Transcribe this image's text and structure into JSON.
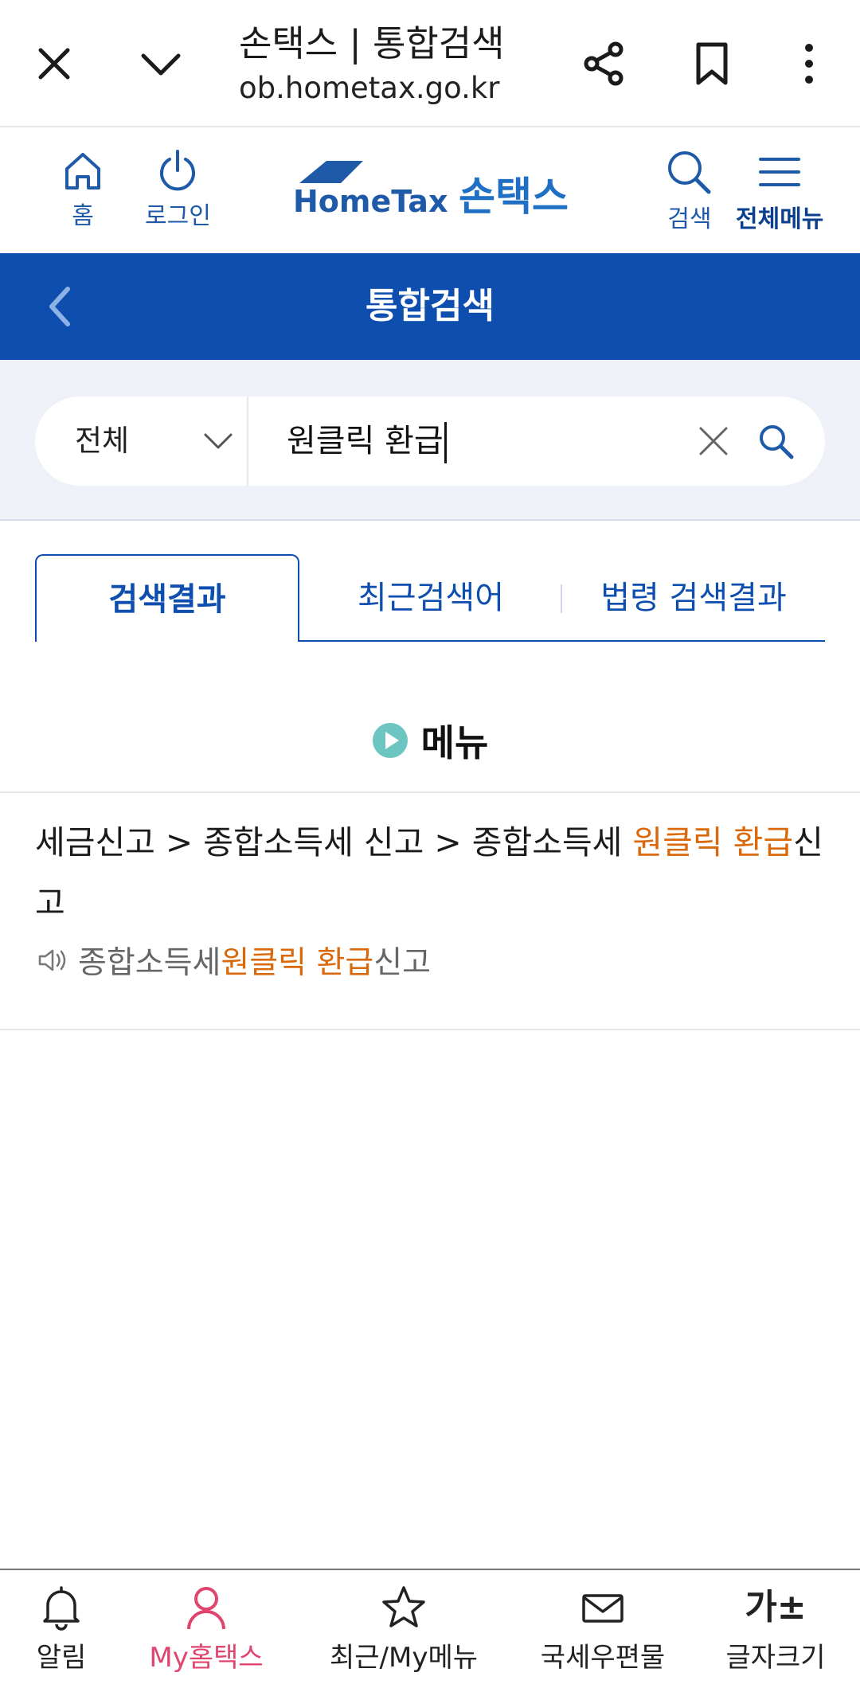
{
  "browser": {
    "title": "손택스 | 통합검색",
    "url": "ob.hometax.go.kr",
    "icons": [
      "close-icon",
      "chevron-down-icon",
      "share-icon",
      "bookmark-icon",
      "more-icon"
    ]
  },
  "header": {
    "home_label": "홈",
    "login_label": "로그인",
    "logo_brand": "HomeTax",
    "logo_korean": "손택스",
    "search_label": "검색",
    "menu_label": "전체메뉴"
  },
  "title_band": {
    "title": "통합검색"
  },
  "search": {
    "scope": "전체",
    "query": "원클릭 환급"
  },
  "tabs": [
    {
      "label": "검색결과",
      "active": true
    },
    {
      "label": "최근검색어",
      "active": false
    },
    {
      "label": "법령 검색결과",
      "active": false
    }
  ],
  "results": {
    "section_title": "메뉴",
    "item": {
      "path_pre": "세금신고 > 종합소득세 신고 > 종합소득세 ",
      "path_hl": "원클릭 환급",
      "path_post": "신고",
      "sub_pre": "종합소득세 ",
      "sub_hl": "원클릭 환급",
      "sub_post": "신고"
    }
  },
  "bottom_nav": [
    {
      "label": "알림",
      "icon": "bell-icon",
      "active": false
    },
    {
      "label": "My홈택스",
      "icon": "person-icon",
      "active": true
    },
    {
      "label": "최근/My메뉴",
      "icon": "star-icon",
      "active": false
    },
    {
      "label": "국세우편물",
      "icon": "mail-icon",
      "active": false
    },
    {
      "label": "글자크기",
      "icon": "font-size-icon",
      "glyph": "가±",
      "active": false
    }
  ],
  "colors": {
    "primary_blue": "#0d4eaf",
    "highlight_orange": "#d9690a",
    "active_pink": "#e0456e",
    "search_bg": "#eef1f7"
  }
}
